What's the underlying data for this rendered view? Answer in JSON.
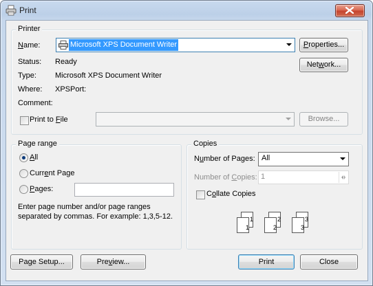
{
  "window": {
    "title": "Print"
  },
  "printer": {
    "group_label": "Printer",
    "name_label": "Name:",
    "name_value": "Microsoft XPS Document Writer",
    "status_label": "Status:",
    "status_value": "Ready",
    "type_label": "Type:",
    "type_value": "Microsoft XPS Document Writer",
    "where_label": "Where:",
    "where_value": "XPSPort:",
    "comment_label": "Comment:",
    "comment_value": "",
    "print_to_file_label": "Print to File",
    "properties_button": "Properties...",
    "network_button": "Network...",
    "browse_button": "Browse..."
  },
  "page_range": {
    "group_label": "Page range",
    "all_label": "All",
    "current_page_label": "Current Page",
    "pages_label": "Pages:",
    "hint": "Enter page number and/or page ranges separated by commas. For example: 1,3,5-12."
  },
  "copies": {
    "group_label": "Copies",
    "number_of_pages_label": "Number of Pages:",
    "number_of_pages_value": "All",
    "number_of_copies_label": "Number of Copies:",
    "number_of_copies_value": "1",
    "collate_label": "Collate Copies",
    "collate_pages": [
      "1",
      "2",
      "3"
    ]
  },
  "footer": {
    "page_setup_button": "Page Setup...",
    "preview_button": "Preview...",
    "print_button": "Print",
    "close_button": "Close"
  },
  "colors": {
    "title_bar": "#c9daee",
    "close_button": "#c5432d",
    "dialog_background": "#f0f0f0",
    "focus_border": "#3c7fb1"
  },
  "icons": [
    "printer-icon",
    "close-icon",
    "dropdown-arrow-icon",
    "spin-up-icon",
    "spin-down-icon",
    "collate-pages-icon"
  ]
}
